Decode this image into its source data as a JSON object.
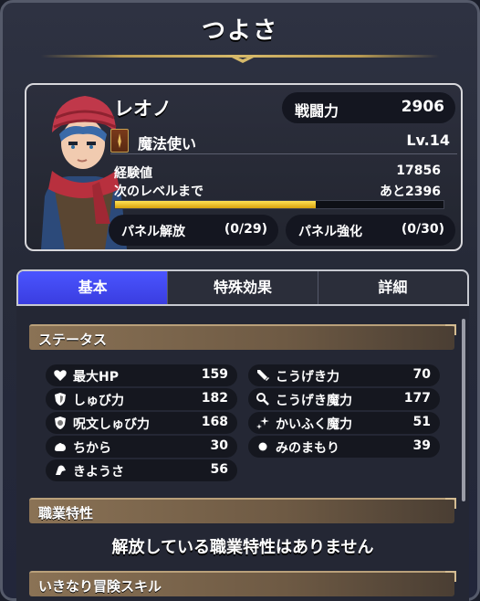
{
  "screen": {
    "title": "つよさ"
  },
  "character": {
    "name": "レオノ",
    "power_label": "戦闘力",
    "power_value": "2906",
    "job": "魔法使い",
    "level": "Lv.14",
    "exp_label": "経験値",
    "exp_value": "17856",
    "next_label": "次のレベルまで",
    "next_value": "あと2396",
    "exp_progress_percent": 61,
    "panel_unlock_label": "パネル解放",
    "panel_unlock_value": "(0/29)",
    "panel_boost_label": "パネル強化",
    "panel_boost_value": "(0/30)"
  },
  "tabs": [
    {
      "label": "基本",
      "active": true
    },
    {
      "label": "特殊効果",
      "active": false
    },
    {
      "label": "詳細",
      "active": false
    }
  ],
  "status": {
    "header": "ステータス",
    "left": [
      {
        "icon": "heart-icon",
        "label": "最大HP",
        "value": "159"
      },
      {
        "icon": "shield-icon",
        "label": "しゅび力",
        "value": "182"
      },
      {
        "icon": "spell-shield-icon",
        "label": "呪文しゅび力",
        "value": "168"
      },
      {
        "icon": "strength-icon",
        "label": "ちから",
        "value": "30"
      },
      {
        "icon": "dexterity-icon",
        "label": "きようさ",
        "value": "56"
      }
    ],
    "right": [
      {
        "icon": "sword-icon",
        "label": "こうげき力",
        "value": "70"
      },
      {
        "icon": "magic-attack-icon",
        "label": "こうげき魔力",
        "value": "177"
      },
      {
        "icon": "sparkle-icon",
        "label": "かいふく魔力",
        "value": "51"
      },
      {
        "icon": "orb-icon",
        "label": "みのまもり",
        "value": "39"
      }
    ]
  },
  "traits": {
    "header": "職業特性",
    "empty_text": "解放している職業特性はありません"
  },
  "skills": {
    "header": "いきなり冒険スキル"
  },
  "colors": {
    "tab_active": "#3a3de0",
    "exp_bar": "#f0c020",
    "section_header": "#7a6450"
  }
}
